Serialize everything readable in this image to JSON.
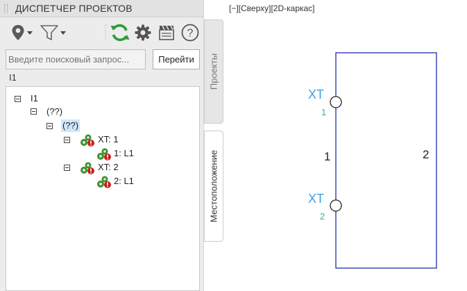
{
  "panel": {
    "title": "ДИСПЕТЧЕР ПРОЕКТОВ",
    "toolbar": {
      "icons": [
        "location-pin-icon",
        "filter-icon",
        "refresh-icon",
        "gear-icon",
        "clapperboard-icon",
        "help-icon"
      ],
      "help_glyph": "?"
    },
    "search": {
      "placeholder": "Введите поисковый запрос...",
      "value": ""
    },
    "go_button": "Перейти",
    "breadcrumb": "I1",
    "tree": {
      "root": "I1",
      "level1": "(??)",
      "level2": "(??)",
      "connector1": {
        "label": "XT: 1",
        "pin": "1: L1"
      },
      "connector2": {
        "label": "XT: 2",
        "pin": "2: L1"
      }
    },
    "side_tabs": {
      "projects": "Проекты",
      "location": "Местоположение"
    }
  },
  "viewport": {
    "label": "[−][Сверху][2D-каркас]",
    "drawing": {
      "connector1": {
        "tag": "XT",
        "index": "1"
      },
      "connector2": {
        "tag": "XT",
        "index": "2"
      },
      "left_number": "1",
      "right_number": "2"
    },
    "colors": {
      "frame": "#1f2ea8",
      "tag": "#3aa0e6",
      "index": "#3bb39a"
    }
  }
}
